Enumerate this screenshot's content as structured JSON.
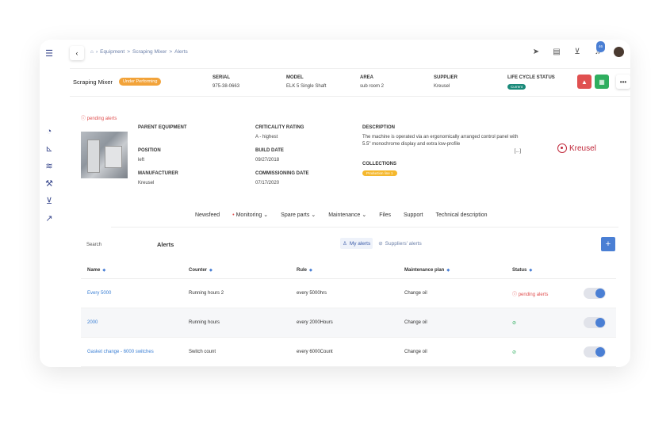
{
  "breadcrumb": {
    "items": [
      "Equipment",
      "Scraping Mixer",
      "Alerts"
    ],
    "separator": ">"
  },
  "topbar": {
    "notification_count": "46"
  },
  "header": {
    "title": "Scraping Mixer",
    "status_badge": "Under Performing",
    "columns": [
      {
        "label": "SERIAL",
        "value": "975-38-0663"
      },
      {
        "label": "MODEL",
        "value": "ELK 5 Single Shaft"
      },
      {
        "label": "AREA",
        "value": "sub room 2"
      },
      {
        "label": "SUPPLIER",
        "value": "Kreusel"
      }
    ],
    "lifecycle": {
      "label": "LIFE CYCLE STATUS",
      "value": "Current"
    }
  },
  "details": {
    "pending_alerts": "pending alerts",
    "parent_equipment": {
      "label": "PARENT EQUIPMENT",
      "value": ""
    },
    "position": {
      "label": "POSITION",
      "value": "left"
    },
    "manufacturer": {
      "label": "MANUFACTURER",
      "value": "Kreusel"
    },
    "criticality": {
      "label": "CRITICALITY RATING",
      "value": "A - highest"
    },
    "build_date": {
      "label": "BUILD DATE",
      "value": "09/27/2018"
    },
    "commissioning_date": {
      "label": "COMMISSIONING DATE",
      "value": "07/17/2020"
    },
    "description": {
      "label": "DESCRIPTION",
      "value": "The machine is operated via an ergonomically arranged control panel with 5.5\" monochrome display and extra low-profile",
      "more": "[...]"
    },
    "collections": {
      "label": "COLLECTIONS",
      "value": "Production line 1"
    },
    "supplier_logo": "Kreusel"
  },
  "tabs": [
    {
      "label": "Newsfeed"
    },
    {
      "label": "Monitoring",
      "dot": "•",
      "caret": "⌄"
    },
    {
      "label": "Spare parts",
      "caret": "⌄"
    },
    {
      "label": "Maintenance",
      "caret": "⌄"
    },
    {
      "label": "Files"
    },
    {
      "label": "Support"
    },
    {
      "label": "Technical description"
    }
  ],
  "alerts": {
    "search_label": "Search",
    "title": "Alerts",
    "my_alerts": "My alerts",
    "suppliers_alerts": "Suppliers' alerts",
    "add": "+",
    "columns": [
      "Name",
      "Counter",
      "Rule",
      "Maintenance plan",
      "Status"
    ],
    "rows": [
      {
        "name": "Every 5000",
        "counter": "Running hours 2",
        "rule": "every 5000hrs",
        "plan": "Change oil",
        "status": "pending alerts",
        "status_type": "pending"
      },
      {
        "name": "2000",
        "counter": "Running hours",
        "rule": "every 2000Hours",
        "plan": "Change oil",
        "status": "",
        "status_type": "ok"
      },
      {
        "name": "Gasket change - 6000 switches",
        "counter": "Switch count",
        "rule": "every 6000Count",
        "plan": "Change oil",
        "status": "",
        "status_type": "ok"
      }
    ]
  },
  "colors": {
    "accent": "#4a7fd4",
    "warning": "#f2a33a",
    "danger": "#e05050",
    "success": "#2fae5f",
    "brand": "#c0283a"
  }
}
